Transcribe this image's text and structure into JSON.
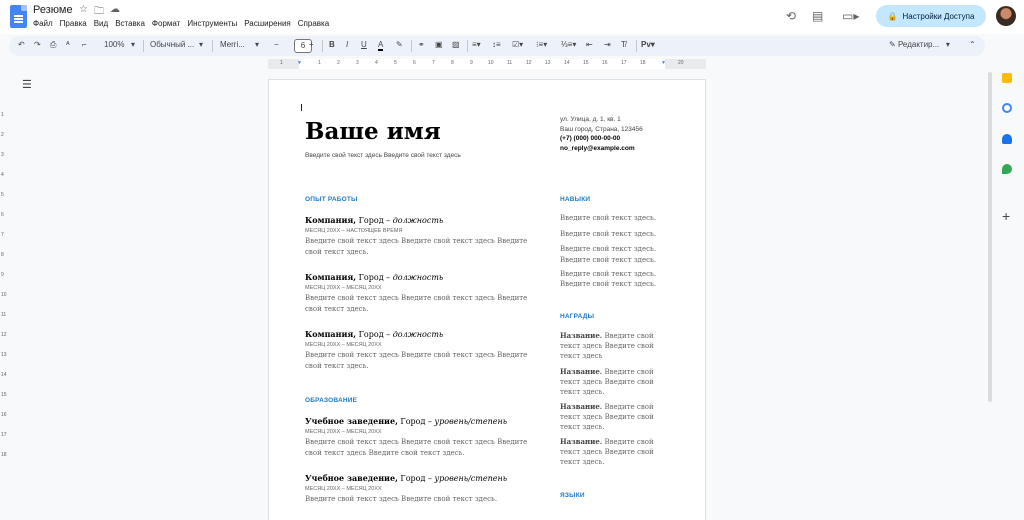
{
  "app": {
    "doc_title": "Резюме",
    "menu": [
      "Файл",
      "Правка",
      "Вид",
      "Вставка",
      "Формат",
      "Инструменты",
      "Расширения",
      "Справка"
    ],
    "share_label": "Настройки Доступа",
    "icons": [
      "star-icon",
      "folder-icon",
      "cloud-icon",
      "history-icon",
      "comment-icon",
      "video-icon",
      "lock-icon"
    ]
  },
  "toolbar": {
    "zoom": "100%",
    "style": "Обычный ...",
    "font": "Merri...",
    "font_size": "6",
    "edit_mode": "Редактир..."
  },
  "ruler": {
    "ticks": [
      "1",
      "1",
      "2",
      "3",
      "4",
      "5",
      "6",
      "7",
      "8",
      "9",
      "10",
      "11",
      "12",
      "13",
      "14",
      "15",
      "16",
      "17",
      "18",
      "19",
      "20"
    ],
    "left_ticks": [
      "1",
      "2",
      "3",
      "4",
      "5",
      "6",
      "7",
      "8",
      "9",
      "10",
      "11",
      "12",
      "13",
      "14",
      "15",
      "16",
      "17",
      "18"
    ]
  },
  "resume": {
    "name": "Ваше имя",
    "subtitle": "Введите свой текст здесь Введите свой текст здесь",
    "contact": {
      "street": "ул. Улица, д. 1, кв. 1",
      "city": "Ваш город, Страна, 123456",
      "phone": "(+7) (000) 000-00-00",
      "email": "no_reply@example.com"
    },
    "sections": {
      "work": "ОПЫТ РАБОТЫ",
      "education": "ОБРАЗОВАНИЕ",
      "skills": "НАВЫКИ",
      "awards": "НАГРАДЫ",
      "languages": "ЯЗЫКИ"
    },
    "work": [
      {
        "company": "Компания,",
        "city": " Город – ",
        "role": "должность",
        "date": "МЕСЯЦ 20XX – НАСТОЯЩЕЕ ВРЕМЯ",
        "text": "Введите свой текст здесь Введите свой текст здесь Введите свой текст здесь."
      },
      {
        "company": "Компания,",
        "city": " Город – ",
        "role": "должность",
        "date": "МЕСЯЦ 20XX – МЕСЯЦ 20XX",
        "text": "Введите свой текст здесь Введите свой текст здесь Введите свой текст здесь."
      },
      {
        "company": "Компания,",
        "city": " Город – ",
        "role": "должность",
        "date": "МЕСЯЦ 20XX – МЕСЯЦ 20XX",
        "text": "Введите свой текст здесь Введите свой текст здесь Введите свой текст здесь."
      }
    ],
    "education": [
      {
        "school": "Учебное заведение,",
        "city": " Город – ",
        "degree": "уровень/степень",
        "date": "МЕСЯЦ 20XX – МЕСЯЦ 20XX",
        "text": "Введите свой текст здесь Введите свой текст здесь Введите свой текст здесь Введите свой текст здесь."
      },
      {
        "school": "Учебное заведение,",
        "city": " Город – ",
        "degree": "уровень/степень",
        "date": "МЕСЯЦ 20XX – МЕСЯЦ 20XX",
        "text": "Введите свой текст здесь Введите свой текст здесь."
      }
    ],
    "skills": [
      "Введите свой текст здесь.",
      "Введите свой текст здесь.",
      "Введите свой текст здесь.",
      "Введите свой текст здесь.",
      "Введите свой текст здесь."
    ],
    "awards": [
      {
        "label": "Название.",
        "text": " Введите свой текст здесь Введите свой текст здесь"
      },
      {
        "label": "Название.",
        "text": " Введите свой текст здесь Введите свой текст здесь."
      },
      {
        "label": "Название.",
        "text": " Введите свой текст здесь Введите свой текст здесь."
      },
      {
        "label": "Название.",
        "text": " Введите свой текст здесь Введите свой текст здесь."
      }
    ]
  },
  "colors": {
    "accent": "#2079c7",
    "share_bg": "#c2e7ff",
    "docs_blue": "#4285f4"
  }
}
